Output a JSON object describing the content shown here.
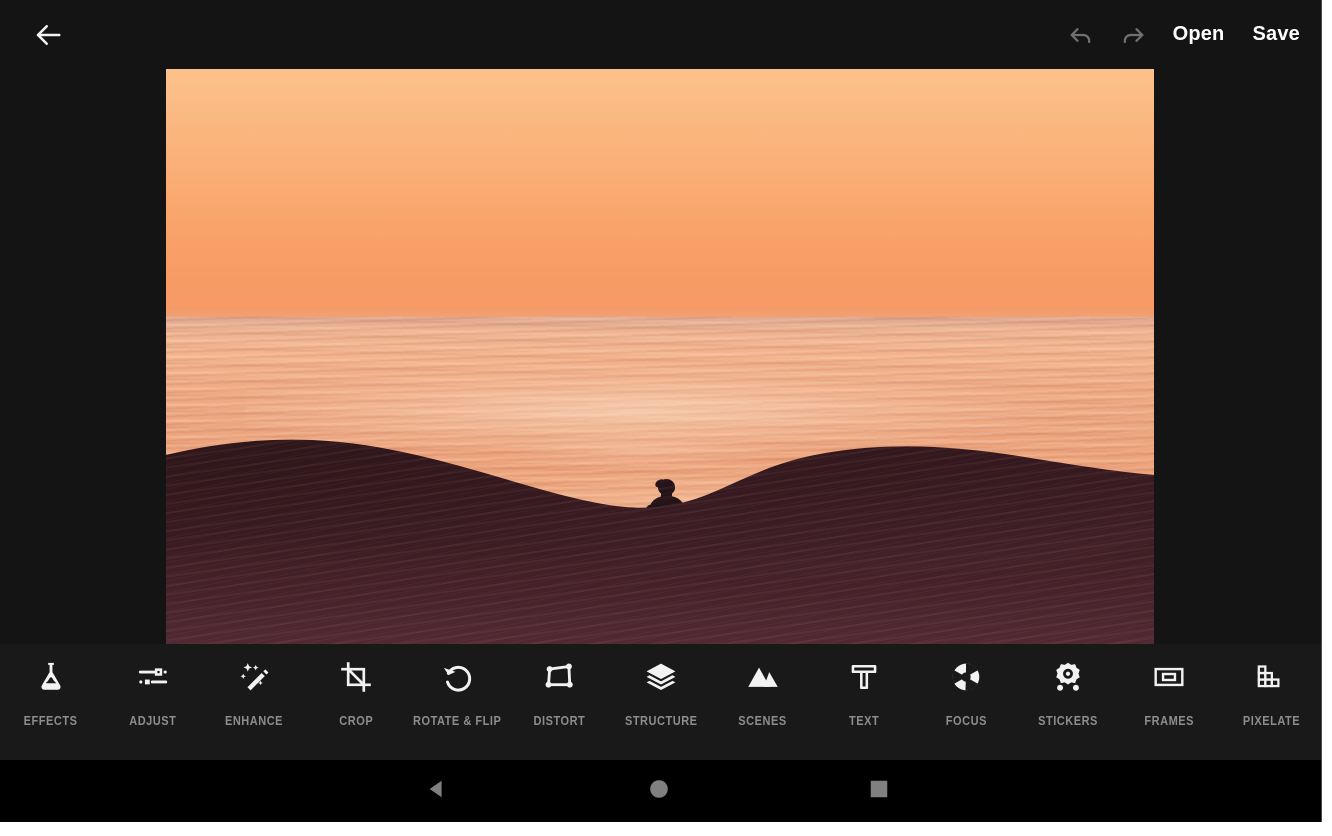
{
  "app": {
    "name": "Photo Editor",
    "background_color": "#141414",
    "toolbar_color": "#191919",
    "accent_text_color": "#ffffff",
    "label_color": "#8d8d8d"
  },
  "topbar": {
    "back_icon": "arrow-left-icon",
    "undo_icon": "undo-arrow-icon",
    "redo_icon": "redo-arrow-icon",
    "undo_enabled": "false",
    "redo_enabled": "false",
    "open_label": "Open",
    "save_label": "Save"
  },
  "canvas": {
    "image_description": "Sunset seascape with silhouetted surfer sitting in the water beyond a dark breaking wave",
    "sky_top_color": "#fcc28c",
    "sky_bottom_color": "#f79b64",
    "water_color": "#f0ad84",
    "wave_color": "#2b161b"
  },
  "toolbar": {
    "items": [
      {
        "label": "EFFECTS",
        "icon": "flask-icon"
      },
      {
        "label": "ADJUST",
        "icon": "sliders-icon"
      },
      {
        "label": "ENHANCE",
        "icon": "magic-wand-icon"
      },
      {
        "label": "CROP",
        "icon": "crop-icon"
      },
      {
        "label": "ROTATE & FLIP",
        "icon": "rotate-left-icon"
      },
      {
        "label": "DISTORT",
        "icon": "distort-quad-icon"
      },
      {
        "label": "STRUCTURE",
        "icon": "layers-icon"
      },
      {
        "label": "SCENES",
        "icon": "mountains-icon"
      },
      {
        "label": "TEXT",
        "icon": "text-t-icon"
      },
      {
        "label": "FOCUS",
        "icon": "aperture-icon"
      },
      {
        "label": "STICKERS",
        "icon": "sticker-badge-icon"
      },
      {
        "label": "FRAMES",
        "icon": "frame-rect-icon"
      },
      {
        "label": "PIXELATE",
        "icon": "pixelate-blocks-icon"
      }
    ]
  },
  "navbar": {
    "back_icon": "nav-back-triangle-icon",
    "home_icon": "nav-home-circle-icon",
    "recents_icon": "nav-recents-square-icon",
    "icon_color": "#808080"
  }
}
